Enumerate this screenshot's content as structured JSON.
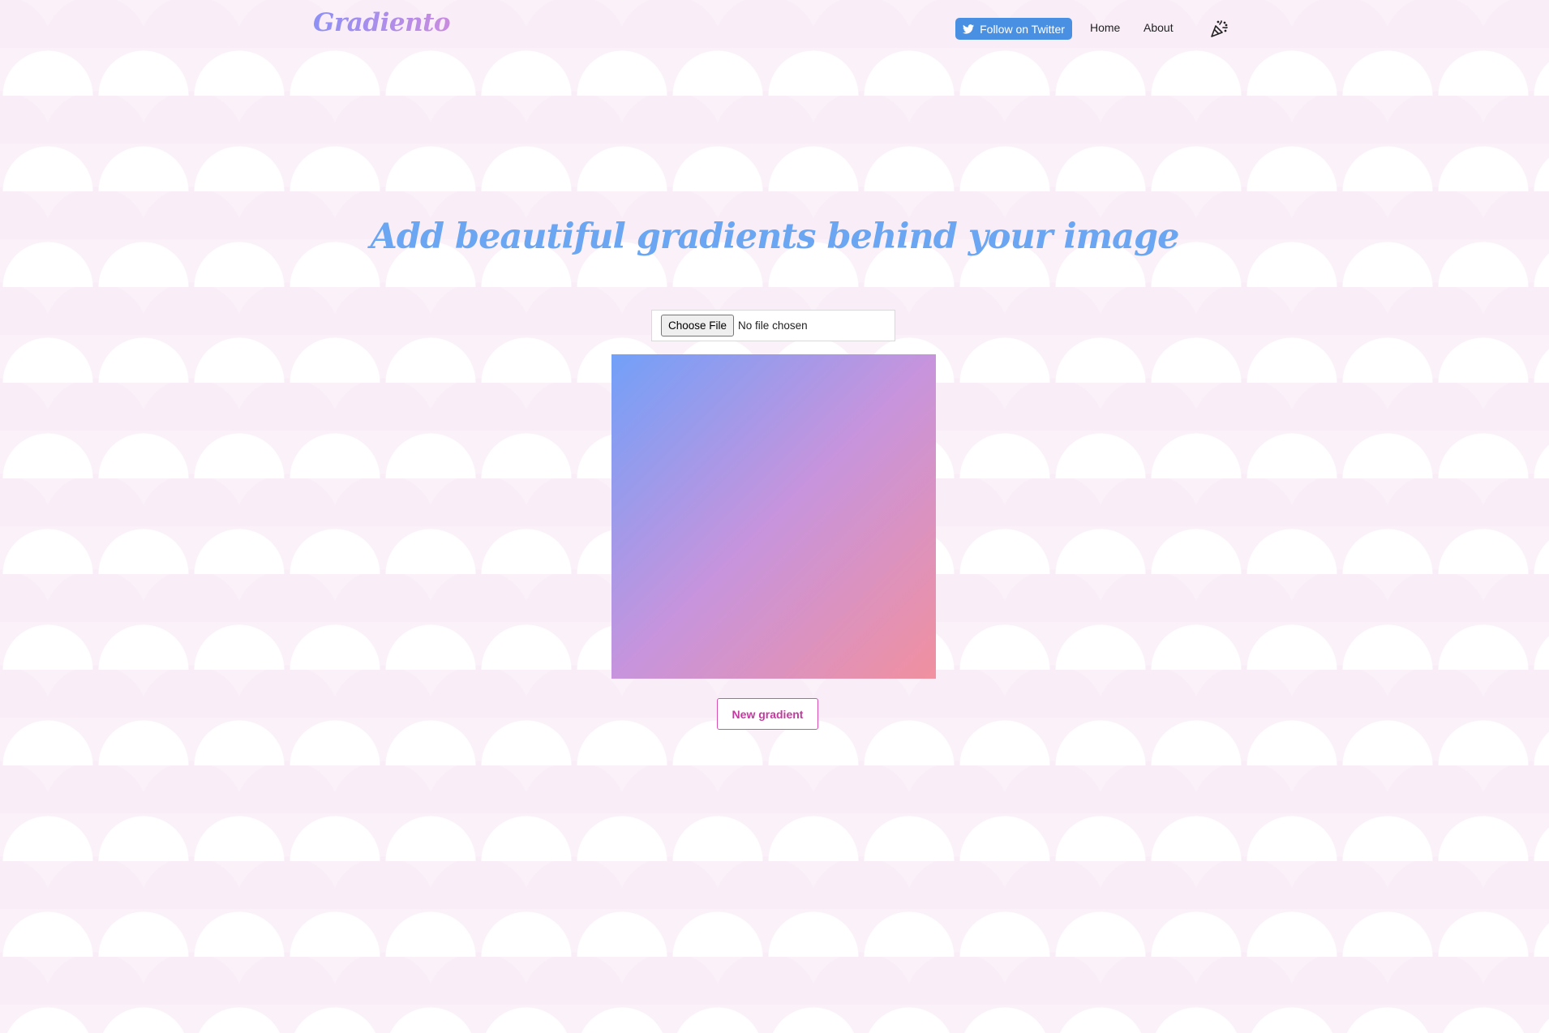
{
  "header": {
    "logo_text": "Gradiento",
    "twitter_button_label": "Follow on Twitter",
    "nav_items": [
      "Home",
      "About"
    ],
    "party_icon": "party-popper-icon",
    "twitter_icon": "twitter-bird-icon"
  },
  "main": {
    "headline": "Add beautiful gradients behind your image",
    "file_input": {
      "button_label": "Choose File",
      "status_text": "No file chosen"
    },
    "gradient_preview": {
      "start_color": "#72a0f8",
      "mid_color": "#c794dd",
      "end_color": "#f1909f"
    },
    "new_gradient_label": "New gradient"
  },
  "colors": {
    "twitter_button": "#4a90e2",
    "headline": "#6aa6f2",
    "accent": "#d94fb3",
    "background_pattern": "#f9eef8"
  }
}
